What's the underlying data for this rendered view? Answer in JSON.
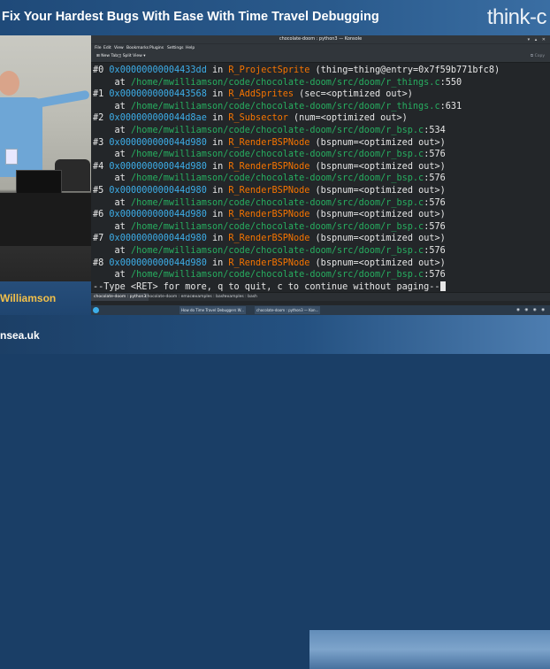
{
  "banner": {
    "title": "Fix Your Hardest Bugs With Ease With Time Travel Debugging",
    "brand": "think-c"
  },
  "speaker": {
    "name": "Williamson"
  },
  "footer": {
    "url": "nsea.uk"
  },
  "window": {
    "title": "chocolate-doom : python3 — Konsole",
    "menu": [
      "File",
      "Edit",
      "View",
      "Bookmarks",
      "Plugins",
      "Settings",
      "Help"
    ],
    "toolbar": {
      "new_tab": "New Tab",
      "split_view": "Split View",
      "copy": "Copy"
    },
    "tabs": [
      "chocolate-doom : python3",
      "chocolate-doom : emacs",
      "examples : bash",
      "examples : bash"
    ]
  },
  "terminal": {
    "lines": [
      {
        "frame": "#0",
        "addr": "0x00000000004433dd",
        "fn": "R_ProjectSprite",
        "args": "(thing=thing@entry=0x7f59b771bfc8)",
        "path": "/home/mwilliamson/code/chocolate-doom/src/doom/r_things.c",
        "line": "550"
      },
      {
        "frame": "#1",
        "addr": "0x0000000000443568",
        "fn": "R_AddSprites",
        "args": "(sec=<optimized out>)",
        "path": "/home/mwilliamson/code/chocolate-doom/src/doom/r_things.c",
        "line": "631"
      },
      {
        "frame": "#2",
        "addr": "0x000000000044d8ae",
        "fn": "R_Subsector",
        "args": "(num=<optimized out>)",
        "path": "/home/mwilliamson/code/chocolate-doom/src/doom/r_bsp.c",
        "line": "534"
      },
      {
        "frame": "#3",
        "addr": "0x000000000044d980",
        "fn": "R_RenderBSPNode",
        "args": "(bspnum=<optimized out>)",
        "path": "/home/mwilliamson/code/chocolate-doom/src/doom/r_bsp.c",
        "line": "576"
      },
      {
        "frame": "#4",
        "addr": "0x000000000044d980",
        "fn": "R_RenderBSPNode",
        "args": "(bspnum=<optimized out>)",
        "path": "/home/mwilliamson/code/chocolate-doom/src/doom/r_bsp.c",
        "line": "576"
      },
      {
        "frame": "#5",
        "addr": "0x000000000044d980",
        "fn": "R_RenderBSPNode",
        "args": "(bspnum=<optimized out>)",
        "path": "/home/mwilliamson/code/chocolate-doom/src/doom/r_bsp.c",
        "line": "576"
      },
      {
        "frame": "#6",
        "addr": "0x000000000044d980",
        "fn": "R_RenderBSPNode",
        "args": "(bspnum=<optimized out>)",
        "path": "/home/mwilliamson/code/chocolate-doom/src/doom/r_bsp.c",
        "line": "576"
      },
      {
        "frame": "#7",
        "addr": "0x000000000044d980",
        "fn": "R_RenderBSPNode",
        "args": "(bspnum=<optimized out>)",
        "path": "/home/mwilliamson/code/chocolate-doom/src/doom/r_bsp.c",
        "line": "576"
      },
      {
        "frame": "#8",
        "addr": "0x000000000044d980",
        "fn": "R_RenderBSPNode",
        "args": "(bspnum=<optimized out>)",
        "path": "/home/mwilliamson/code/chocolate-doom/src/doom/r_bsp.c",
        "line": "576"
      }
    ],
    "in_word": "in",
    "at_word": "at",
    "pager_prompt": "--Type <RET> for more, q to quit, c to continue without paging--"
  },
  "taskbar": {
    "apps": [
      "How do Time Travel Debuggers W...",
      "chocolate-doom : python3 — Kon..."
    ]
  }
}
